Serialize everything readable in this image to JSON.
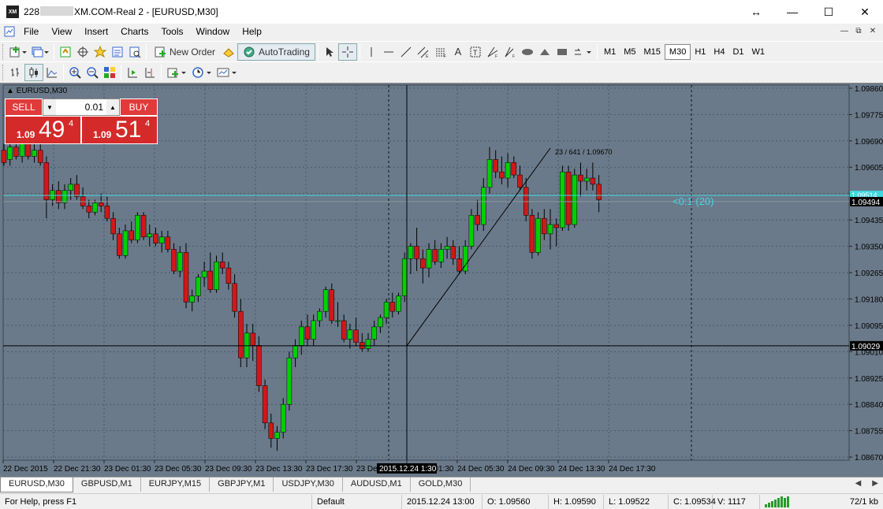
{
  "window": {
    "title_prefix": "228",
    "title_suffix": "XM.COM-Real 2 - [EURUSD,M30]",
    "logo": "XM"
  },
  "menu": [
    "File",
    "View",
    "Insert",
    "Charts",
    "Tools",
    "Window",
    "Help"
  ],
  "toolbar": {
    "new_order_label": "New Order",
    "autotrading_label": "AutoTrading",
    "timeframes": [
      "M1",
      "M5",
      "M15",
      "M30",
      "H1",
      "H4",
      "D1",
      "W1"
    ],
    "active_timeframe": "M30"
  },
  "chart": {
    "label": "EURUSD,M30",
    "trade_panel": {
      "sell_label": "SELL",
      "buy_label": "BUY",
      "lot": "0.01",
      "sell_small": "1.09",
      "sell_big": "49",
      "sell_sup": "4",
      "buy_small": "1.09",
      "buy_big": "51",
      "buy_sup": "4"
    },
    "price_ticks": [
      "1.09860",
      "1.09775",
      "1.09690",
      "1.09605",
      "1.09520",
      "1.09435",
      "1.09350",
      "1.09265",
      "1.09180",
      "1.09095",
      "1.09010",
      "1.08925",
      "1.08840",
      "1.08755",
      "1.08670"
    ],
    "time_ticks": [
      "22 Dec 2015",
      "22 Dec 21:30",
      "23 Dec 01:30",
      "23 Dec 05:30",
      "23 Dec 09:30",
      "23 Dec 13:30",
      "23 Dec 17:30",
      "23 Dec 21:30",
      "24 Dec 01:30",
      "24 Dec 05:30",
      "24 Dec 09:30",
      "24 Dec 13:30",
      "24 Dec 17:30"
    ],
    "crosshair_time": "2015.12.24 1:30",
    "crosshair_price": "1.09029",
    "bid_price": "1.09494",
    "cyan_line_label": "1.09514",
    "trend_label": "23 / 641 / 1.09670",
    "range_label": "<0:1 (20)",
    "colors": {
      "background": "#6b7a8a",
      "bull": "#00d000",
      "bear": "#d01818",
      "cyan": "#40d8e0",
      "grid": "#4a5866"
    }
  },
  "tabs": [
    "EURUSD,M30",
    "GBPUSD,M1",
    "EURJPY,M15",
    "GBPJPY,M1",
    "USDJPY,M30",
    "AUDUSD,M1",
    "GOLD,M30"
  ],
  "active_tab": "EURUSD,M30",
  "status": {
    "help": "For Help, press F1",
    "profile": "Default",
    "datetime": "2015.12.24 13:00",
    "open": "O: 1.09560",
    "high": "H: 1.09590",
    "low": "L: 1.09522",
    "close": "C: 1.09534",
    "volume": "V: 1117",
    "traffic": "72/1 kb"
  },
  "chart_data": {
    "type": "candlestick",
    "symbol": "EURUSD",
    "timeframe": "M30",
    "ylim": [
      1.0866,
      1.0987
    ],
    "candles": [
      [
        1.0966,
        1.0968,
        1.0961,
        1.0962
      ],
      [
        1.0963,
        1.0969,
        1.0961,
        1.0967
      ],
      [
        1.0967,
        1.0969,
        1.0963,
        1.0964
      ],
      [
        1.0964,
        1.097,
        1.0962,
        1.0968
      ],
      [
        1.0968,
        1.097,
        1.0963,
        1.0964
      ],
      [
        1.0964,
        1.0969,
        1.0962,
        1.0966
      ],
      [
        1.0966,
        1.0968,
        1.0961,
        1.0962
      ],
      [
        1.0962,
        1.0964,
        1.0944,
        1.095
      ],
      [
        1.095,
        1.0955,
        1.0948,
        1.0953
      ],
      [
        1.0953,
        1.0956,
        1.0947,
        1.0949
      ],
      [
        1.0949,
        1.0955,
        1.0947,
        1.0953
      ],
      [
        1.0953,
        1.0957,
        1.095,
        1.0955
      ],
      [
        1.0955,
        1.0958,
        1.095,
        1.0951
      ],
      [
        1.0951,
        1.0954,
        1.0947,
        1.0948
      ],
      [
        1.0948,
        1.095,
        1.0944,
        1.0946
      ],
      [
        1.0946,
        1.095,
        1.0945,
        1.0949
      ],
      [
        1.0949,
        1.0952,
        1.0946,
        1.0948
      ],
      [
        1.0948,
        1.0951,
        1.0943,
        1.0944
      ],
      [
        1.0944,
        1.0946,
        1.0937,
        1.0939
      ],
      [
        1.0939,
        1.0941,
        1.0931,
        1.0932
      ],
      [
        1.0932,
        1.0942,
        1.0931,
        1.094
      ],
      [
        1.094,
        1.0943,
        1.0936,
        1.0937
      ],
      [
        1.0937,
        1.0946,
        1.0936,
        1.0945
      ],
      [
        1.0945,
        1.0946,
        1.0937,
        1.0938
      ],
      [
        1.0938,
        1.0942,
        1.0935,
        1.0939
      ],
      [
        1.0939,
        1.0941,
        1.0935,
        1.0936
      ],
      [
        1.0936,
        1.094,
        1.0933,
        1.0938
      ],
      [
        1.0938,
        1.094,
        1.0933,
        1.0934
      ],
      [
        1.0934,
        1.0936,
        1.0926,
        1.0927
      ],
      [
        1.0927,
        1.0935,
        1.0925,
        1.0933
      ],
      [
        1.0933,
        1.0936,
        1.0915,
        1.0917
      ],
      [
        1.0917,
        1.0921,
        1.0914,
        1.0919
      ],
      [
        1.0919,
        1.0926,
        1.0917,
        1.0925
      ],
      [
        1.0925,
        1.093,
        1.0922,
        1.0927
      ],
      [
        1.0927,
        1.0933,
        1.092,
        1.0921
      ],
      [
        1.0921,
        1.0932,
        1.092,
        1.093
      ],
      [
        1.093,
        1.0933,
        1.0926,
        1.0928
      ],
      [
        1.0928,
        1.093,
        1.0921,
        1.0923
      ],
      [
        1.0923,
        1.0926,
        1.0912,
        1.0914
      ],
      [
        1.0914,
        1.0918,
        1.0896,
        1.0899
      ],
      [
        1.0899,
        1.091,
        1.0896,
        1.0907
      ],
      [
        1.0907,
        1.091,
        1.0898,
        1.0903
      ],
      [
        1.0903,
        1.0906,
        1.0888,
        1.089
      ],
      [
        1.089,
        1.0892,
        1.0876,
        1.0878
      ],
      [
        1.0878,
        1.0881,
        1.087,
        1.0873
      ],
      [
        1.0873,
        1.0877,
        1.0869,
        1.0875
      ],
      [
        1.0875,
        1.0886,
        1.0873,
        1.0884
      ],
      [
        1.0884,
        1.0901,
        1.0882,
        1.0899
      ],
      [
        1.0899,
        1.0905,
        1.0896,
        1.0903
      ],
      [
        1.0903,
        1.0911,
        1.09,
        1.0909
      ],
      [
        1.0909,
        1.0913,
        1.0903,
        1.0905
      ],
      [
        1.0905,
        1.0913,
        1.0903,
        1.0911
      ],
      [
        1.0911,
        1.0915,
        1.0909,
        1.0914
      ],
      [
        1.0914,
        1.0922,
        1.0912,
        1.0921
      ],
      [
        1.0921,
        1.0923,
        1.091,
        1.0911
      ],
      [
        1.0911,
        1.0917,
        1.0909,
        1.0911
      ],
      [
        1.0911,
        1.0913,
        1.0904,
        1.0905
      ],
      [
        1.0905,
        1.091,
        1.0902,
        1.0908
      ],
      [
        1.0908,
        1.0912,
        1.0903,
        1.0904
      ],
      [
        1.0904,
        1.0907,
        1.0901,
        1.0902
      ],
      [
        1.0902,
        1.0907,
        1.0901,
        1.0905
      ],
      [
        1.0905,
        1.0911,
        1.0903,
        1.0909
      ],
      [
        1.0909,
        1.0913,
        1.0907,
        1.0912
      ],
      [
        1.0912,
        1.0918,
        1.091,
        1.0917
      ],
      [
        1.0917,
        1.092,
        1.0912,
        1.0914
      ],
      [
        1.0914,
        1.092,
        1.0913,
        1.0919
      ],
      [
        1.0919,
        1.0933,
        1.0917,
        1.0931
      ],
      [
        1.0931,
        1.0936,
        1.0926,
        1.0935
      ],
      [
        1.0935,
        1.0941,
        1.0927,
        1.0931
      ],
      [
        1.0931,
        1.0934,
        1.0923,
        1.0928
      ],
      [
        1.0928,
        1.0936,
        1.0925,
        1.0934
      ],
      [
        1.0934,
        1.0937,
        1.0929,
        1.093
      ],
      [
        1.093,
        1.0936,
        1.0928,
        1.0934
      ],
      [
        1.0934,
        1.0938,
        1.0931,
        1.0935
      ],
      [
        1.0935,
        1.0937,
        1.0929,
        1.0931
      ],
      [
        1.0931,
        1.0935,
        1.0926,
        1.0927
      ],
      [
        1.0927,
        1.0937,
        1.0926,
        1.0935
      ],
      [
        1.0935,
        1.0947,
        1.0934,
        1.0945
      ],
      [
        1.0945,
        1.095,
        1.094,
        1.0942
      ],
      [
        1.0942,
        1.0957,
        1.094,
        1.0954
      ],
      [
        1.0954,
        1.0967,
        1.0952,
        1.0963
      ],
      [
        1.0963,
        1.0966,
        1.0957,
        1.0959
      ],
      [
        1.0959,
        1.0964,
        1.0955,
        1.0957
      ],
      [
        1.0957,
        1.0965,
        1.0954,
        1.0962
      ],
      [
        1.0962,
        1.0964,
        1.0957,
        1.0958
      ],
      [
        1.0958,
        1.0961,
        1.0953,
        1.0954
      ],
      [
        1.0954,
        1.0957,
        1.0943,
        1.0945
      ],
      [
        1.0945,
        1.0947,
        1.0931,
        1.0933
      ],
      [
        1.0933,
        1.0946,
        1.0932,
        1.0944
      ],
      [
        1.0944,
        1.0947,
        1.0937,
        1.0939
      ],
      [
        1.0939,
        1.0947,
        1.0934,
        1.0942
      ],
      [
        1.0942,
        1.0944,
        1.0935,
        1.0941
      ],
      [
        1.0941,
        1.0961,
        1.094,
        1.0959
      ],
      [
        1.0959,
        1.0961,
        1.094,
        1.0942
      ],
      [
        1.0942,
        1.096,
        1.0941,
        1.0958
      ],
      [
        1.0958,
        1.0962,
        1.0951,
        1.0956
      ],
      [
        1.0956,
        1.096,
        1.0953,
        1.0957
      ],
      [
        1.0957,
        1.0962,
        1.0953,
        1.0955
      ],
      [
        1.0955,
        1.0958,
        1.0946,
        1.095
      ]
    ]
  }
}
